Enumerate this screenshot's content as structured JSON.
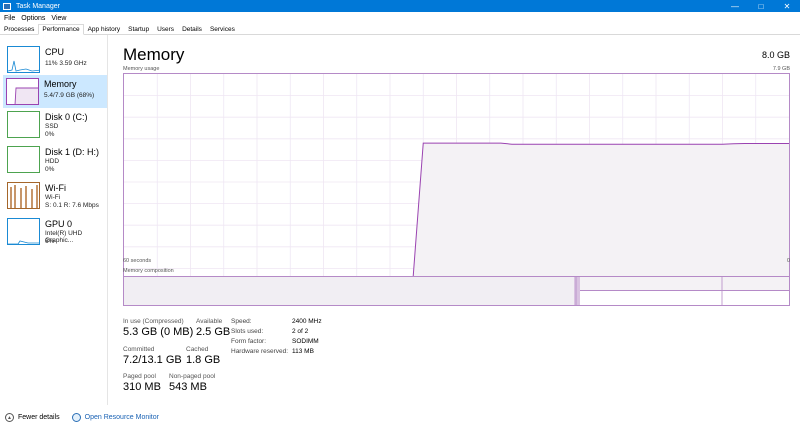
{
  "window": {
    "title": "Task Manager"
  },
  "menu": [
    "File",
    "Options",
    "View"
  ],
  "tabs": [
    "Processes",
    "Performance",
    "App history",
    "Startup",
    "Users",
    "Details",
    "Services"
  ],
  "active_tab": "Performance",
  "sidebar": {
    "items": [
      {
        "name": "CPU",
        "line1": "11% 3.59 GHz",
        "line2": "",
        "color": "#1a8ad4",
        "icon": "cpu-graph"
      },
      {
        "name": "Memory",
        "line1": "5.4/7.9 GB (68%)",
        "line2": "",
        "color": "#9a43b1",
        "icon": "memory-graph"
      },
      {
        "name": "Disk 0 (C:)",
        "line1": "SSD",
        "line2": "0%",
        "color": "#4da34f",
        "icon": "disk-graph"
      },
      {
        "name": "Disk 1 (D: H:)",
        "line1": "HDD",
        "line2": "0%",
        "color": "#4da34f",
        "icon": "disk-graph"
      },
      {
        "name": "Wi-Fi",
        "line1": "Wi-Fi",
        "line2": "S: 0.1  R: 7.6 Mbps",
        "color": "#a5662a",
        "icon": "network-graph"
      },
      {
        "name": "GPU 0",
        "line1": "Intel(R) UHD Graphic...",
        "line2": "6%",
        "color": "#1a8ad4",
        "icon": "gpu-graph"
      }
    ]
  },
  "main": {
    "title": "Memory",
    "total": "8.0 GB",
    "usage_label": "Memory usage",
    "usage_max": "7.9 GB",
    "time_left": "60 seconds",
    "time_right": "0",
    "composition_label": "Memory composition",
    "usage_fraction_series": [
      0,
      0,
      0,
      0,
      0,
      0,
      0,
      0,
      0,
      0,
      0,
      0,
      0,
      0,
      0,
      0,
      0,
      0,
      0,
      0,
      0,
      0,
      0,
      0,
      0,
      0,
      0,
      0.68,
      0.68,
      0.68,
      0.68,
      0.68,
      0.68,
      0.68,
      0.68,
      0.675,
      0.675,
      0.675,
      0.675,
      0.675,
      0.675,
      0.675,
      0.675,
      0.675,
      0.675,
      0.675,
      0.675,
      0.675,
      0.675,
      0.675,
      0.675,
      0.675,
      0.675,
      0.675,
      0.675,
      0.677,
      0.678,
      0.678,
      0.678,
      0.678,
      0.678
    ],
    "stats": [
      {
        "label": "In use (Compressed)",
        "value": "5.3 GB (0 MB)"
      },
      {
        "label": "Available",
        "value": "2.5 GB"
      },
      {
        "label": "Committed",
        "value": "7.2/13.1 GB"
      },
      {
        "label": "Cached",
        "value": "1.8 GB"
      },
      {
        "label": "Paged pool",
        "value": "310 MB"
      },
      {
        "label": "Non-paged pool",
        "value": "543 MB"
      }
    ],
    "hw": [
      {
        "label": "Speed:",
        "value": "2400 MHz"
      },
      {
        "label": "Slots used:",
        "value": "2 of 2"
      },
      {
        "label": "Form factor:",
        "value": "SODIMM"
      },
      {
        "label": "Hardware reserved:",
        "value": "113 MB"
      }
    ]
  },
  "footer": {
    "fewer_details": "Fewer details",
    "open_monitor": "Open Resource Monitor"
  },
  "colors": {
    "accent": "#0078d7",
    "memory": "#9a43b1",
    "memory_fill": "#f4f2f5"
  }
}
